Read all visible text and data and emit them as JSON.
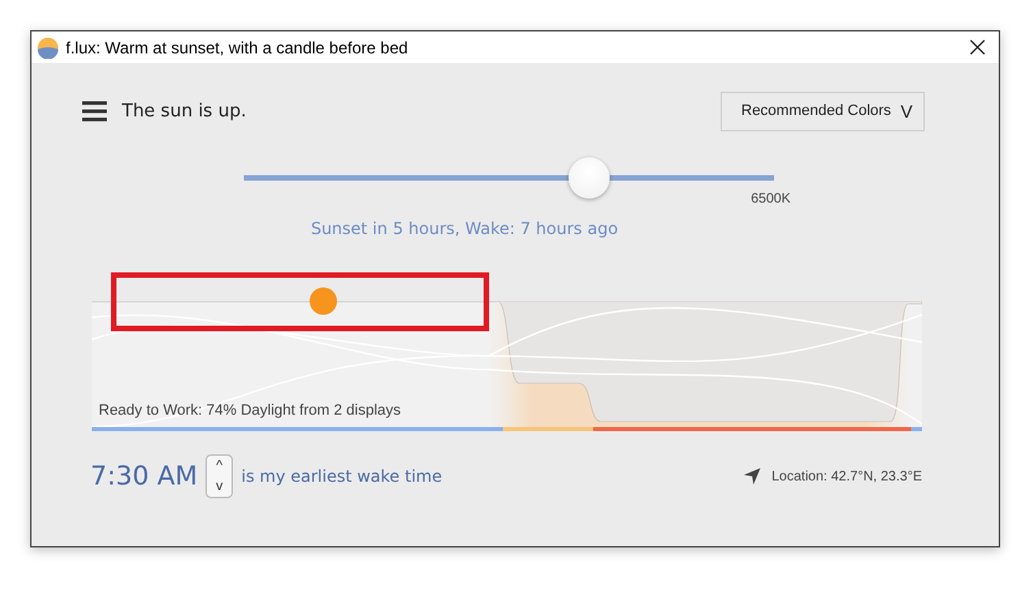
{
  "window": {
    "title": "f.lux: Warm at sunset, with a candle before bed"
  },
  "status": "The sun is up.",
  "preset": {
    "label": "Recommended Colors",
    "caret": "V"
  },
  "slider": {
    "level": 0.65,
    "reading": "6500K"
  },
  "schedule": "Sunset in 5 hours, Wake: 7 hours ago",
  "graph": {
    "caption": "Ready to Work: 74% Daylight from 2 displays"
  },
  "wake": {
    "time": "7:30 AM",
    "up": "^",
    "down": "v",
    "label": "is my earliest wake time"
  },
  "location": "Location: 42.7°N, 23.3°E"
}
